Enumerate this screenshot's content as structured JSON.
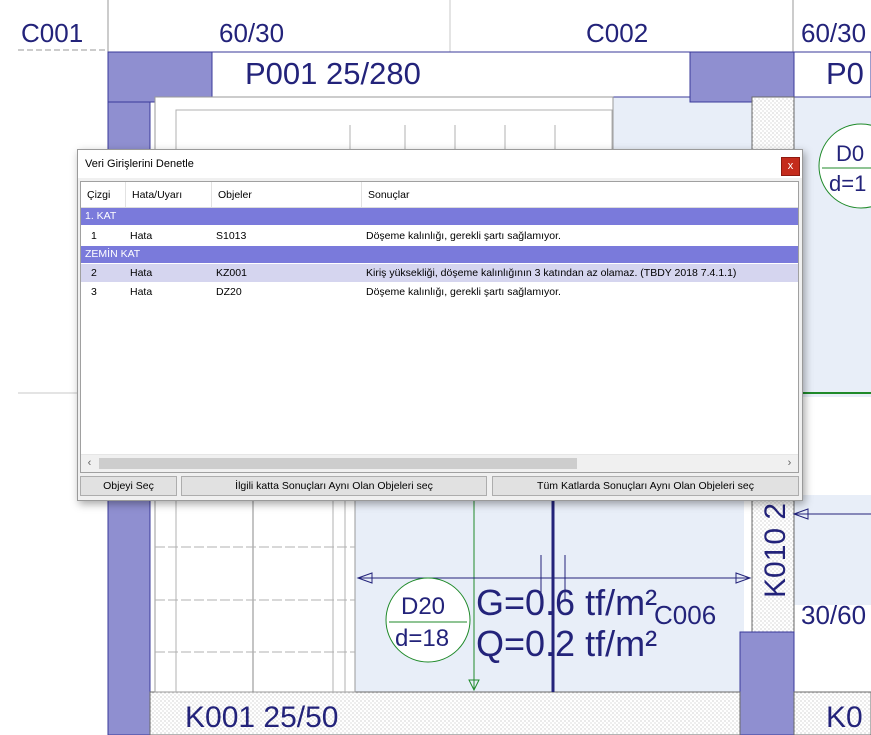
{
  "cad": {
    "labels": {
      "column_c001": "C001",
      "dim_top_left": "60/30",
      "column_c002": "C002",
      "dim_top_right": "60/30",
      "panel_p001": "P001 25/280",
      "panel_right": "P0",
      "slab_right_id": "D0",
      "slab_right_d": "d=1",
      "slab_id": "D20",
      "slab_thickness": "d=18",
      "load_g": "G=0.6 tf/m²",
      "load_q": "Q=0.2 tf/m²",
      "column_c006": "C006",
      "dim_bottom_right": "30/60",
      "beam_k010": "K010 2",
      "beam_k001": "K001 25/50",
      "beam_right_bottom": "K0"
    },
    "colors": {
      "line_dark": "#23237a",
      "column_fill": "#8f8fd0",
      "slab_fill": "#e8eef8",
      "accent_green": "#1f8a2a"
    }
  },
  "dialog": {
    "title": "Veri Girişlerini Denetle",
    "close_label": "x",
    "columns": [
      "Çizgi",
      "Hata/Uyarı",
      "Objeler",
      "Sonuçlar"
    ],
    "groups": [
      {
        "name": "1. KAT",
        "rows": [
          {
            "line": "1",
            "type": "Hata",
            "object": "S1013",
            "result": "Döşeme kalınlığı, gerekli şartı sağlamıyor."
          }
        ]
      },
      {
        "name": "ZEMİN KAT",
        "rows": [
          {
            "line": "2",
            "type": "Hata",
            "object": "KZ001",
            "result": "Kiriş yüksekliği, döşeme kalınlığının 3 katından az olamaz. (TBDY 2018 7.4.1.1)"
          },
          {
            "line": "3",
            "type": "Hata",
            "object": "DZ20",
            "result": "Döşeme kalınlığı, gerekli şartı sağlamıyor."
          }
        ]
      }
    ],
    "selected_row": "2",
    "scroll_left_icon": "chevron-left-icon",
    "scroll_right_icon": "chevron-right-icon",
    "buttons": {
      "select_object": "Objeyi Seç",
      "select_same_floor": "İlgili katta Sonuçları Aynı Olan Objeleri seç",
      "select_all_floors": "Tüm Katlarda Sonuçları Aynı Olan Objeleri seç"
    }
  }
}
